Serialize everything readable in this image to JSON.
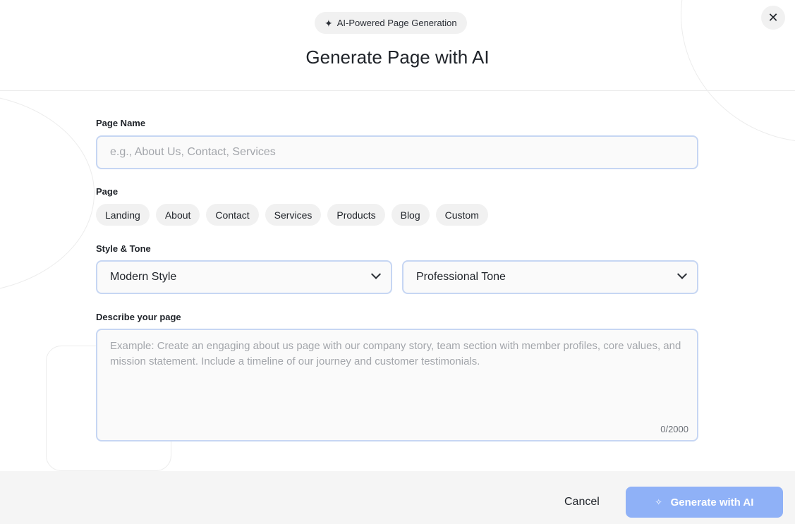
{
  "header": {
    "badge_icon": "✦",
    "badge_label": "AI-Powered Page Generation",
    "title": "Generate Page with AI",
    "close_icon": "✕"
  },
  "form": {
    "page_name": {
      "label": "Page Name",
      "value": "",
      "placeholder": "e.g., About Us, Contact, Services"
    },
    "page_type": {
      "label": "Page",
      "options": [
        "Landing",
        "About",
        "Contact",
        "Services",
        "Products",
        "Blog",
        "Custom"
      ]
    },
    "style_tone": {
      "label": "Style & Tone",
      "style_value": "Modern Style",
      "tone_value": "Professional Tone"
    },
    "description": {
      "label": "Describe your page",
      "value": "",
      "placeholder": "Example: Create an engaging about us page with our company story, team section with member profiles, core values, and mission statement. Include a timeline of our journey and customer testimonials.",
      "counter": "0/2000"
    }
  },
  "footer": {
    "cancel_label": "Cancel",
    "generate_icon": "✧",
    "generate_label": "Generate with AI"
  },
  "colors": {
    "accent": "#8fb1f7",
    "input_border": "#c6d6f3",
    "chip_bg": "#f1f1f1"
  }
}
